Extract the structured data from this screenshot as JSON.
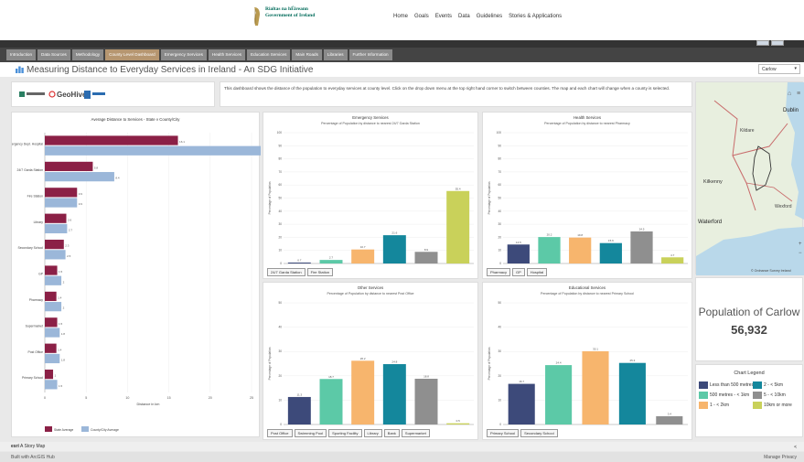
{
  "header": {
    "gov_line1": "Rialtas na hÉireann",
    "gov_line2": "Government of Ireland",
    "nav": [
      "Home",
      "Goals",
      "Events",
      "Data",
      "Guidelines",
      "Stories & Applications"
    ]
  },
  "tabs": [
    "Introduction",
    "Data Sources",
    "Methodology",
    "County Level Dashboard",
    "Emergency Services",
    "Health Services",
    "Education Services",
    "Main Roads",
    "Libraries",
    "Further Information"
  ],
  "page": {
    "title": "Measuring Distance to Everyday Services in Ireland - An SDG Initiative",
    "county": "Carlow",
    "logo_text": "GeoHive",
    "description": "This dashboard shows the distance of the population to everyday services at county level. Click on the drop down menu at the top right hand corner to switch between counties. The map and each chart will change when a county is selected."
  },
  "map": {
    "labels": [
      "Dublin",
      "Kildare",
      "Kilkenny",
      "Wexford",
      "Waterford"
    ],
    "attribution": "© Ordnance Survey Ireland"
  },
  "population": {
    "label": "Population of Carlow",
    "value": "56,932"
  },
  "legend": {
    "title": "Chart Legend",
    "items": [
      {
        "label": "Less than 500 metres",
        "color": "#3d4a7a"
      },
      {
        "label": "2 - < 5km",
        "color": "#14879c"
      },
      {
        "label": "500 metres - < 1km",
        "color": "#5cc9a7"
      },
      {
        "label": "5 - < 10km",
        "color": "#8f8f8f"
      },
      {
        "label": "1 - < 2km",
        "color": "#f7b56d"
      },
      {
        "label": "10km or more",
        "color": "#c9d15a"
      }
    ]
  },
  "footer": {
    "brand": "esri",
    "story": "A Story Map",
    "built": "Built with ArcGIS Hub",
    "privacy": "Manage Privacy"
  },
  "chart_data": [
    {
      "type": "bar",
      "orientation": "horizontal",
      "title": "Average Distance to Services - State v County/City",
      "xlabel": "Distance in km",
      "xlim": [
        0,
        25
      ],
      "xticks": [
        0,
        5,
        10,
        15,
        20,
        25
      ],
      "categories": [
        "Emergency Dept. Hospital",
        "24/7 Garda Station",
        "Fire Station",
        "Library",
        "Secondary School",
        "GP",
        "Pharmacy",
        "Supermarket",
        "Post Office",
        "Primary School"
      ],
      "series": [
        {
          "name": "State Average",
          "color": "#8b2046",
          "values": [
            16.1,
            5.8,
            3.9,
            2.6,
            2.3,
            1.5,
            1.4,
            1.5,
            1.4,
            1.0
          ]
        },
        {
          "name": "County/City Average",
          "color": "#9bb7d9",
          "values": [
            31.2,
            8.4,
            3.9,
            2.7,
            2.5,
            2.0,
            2.0,
            1.8,
            1.8,
            1.5
          ]
        }
      ]
    },
    {
      "type": "bar",
      "title": "Emergency Services",
      "subtitle": "Percentage of Population by distance to nearest 24/7 Garda Station",
      "ylabel": "Percentage of Population",
      "ylim": [
        0,
        100
      ],
      "yticks": [
        0,
        10,
        20,
        30,
        40,
        50,
        60,
        70,
        80,
        90,
        100
      ],
      "values": [
        0.7,
        2.7,
        10.7,
        21.6,
        8.9,
        55.4
      ],
      "colors": [
        "#3d4a7a",
        "#5cc9a7",
        "#f7b56d",
        "#14879c",
        "#8f8f8f",
        "#c9d15a"
      ],
      "buttons": [
        "24/7 Garda Station",
        "Fire Station"
      ]
    },
    {
      "type": "bar",
      "title": "Health Services",
      "subtitle": "Percentage of Population by distance to nearest Pharmacy",
      "ylabel": "Percentage of Population",
      "ylim": [
        0,
        100
      ],
      "yticks": [
        0,
        10,
        20,
        30,
        40,
        50,
        60,
        70,
        80,
        90,
        100
      ],
      "values": [
        14.5,
        20.2,
        19.8,
        15.6,
        24.5,
        4.7
      ],
      "colors": [
        "#3d4a7a",
        "#5cc9a7",
        "#f7b56d",
        "#14879c",
        "#8f8f8f",
        "#c9d15a"
      ],
      "buttons": [
        "Pharmacy",
        "GP",
        "Hospital"
      ]
    },
    {
      "type": "bar",
      "title": "Other Services",
      "subtitle": "Percentage of Population by distance to nearest Post Office",
      "ylabel": "Percentage of Population",
      "ylim": [
        0,
        50
      ],
      "yticks": [
        0,
        10,
        20,
        30,
        40,
        50
      ],
      "values": [
        11.3,
        18.7,
        26.2,
        24.8,
        18.8,
        0.5
      ],
      "colors": [
        "#3d4a7a",
        "#5cc9a7",
        "#f7b56d",
        "#14879c",
        "#8f8f8f",
        "#c9d15a"
      ],
      "buttons": [
        "Post Office",
        "Swimming Pool",
        "Sporting Facility",
        "Library",
        "Bank",
        "Supermarket"
      ]
    },
    {
      "type": "bar",
      "title": "Educational Services",
      "subtitle": "Percentage of Population by distance to nearest Primary School",
      "ylabel": "Percentage of Population",
      "ylim": [
        0,
        50
      ],
      "yticks": [
        0,
        10,
        20,
        30,
        40,
        50
      ],
      "values": [
        16.7,
        24.4,
        30.1,
        25.3,
        3.4
      ],
      "colors": [
        "#3d4a7a",
        "#5cc9a7",
        "#f7b56d",
        "#14879c",
        "#8f8f8f"
      ],
      "buttons": [
        "Primary School",
        "Secondary School"
      ]
    }
  ]
}
